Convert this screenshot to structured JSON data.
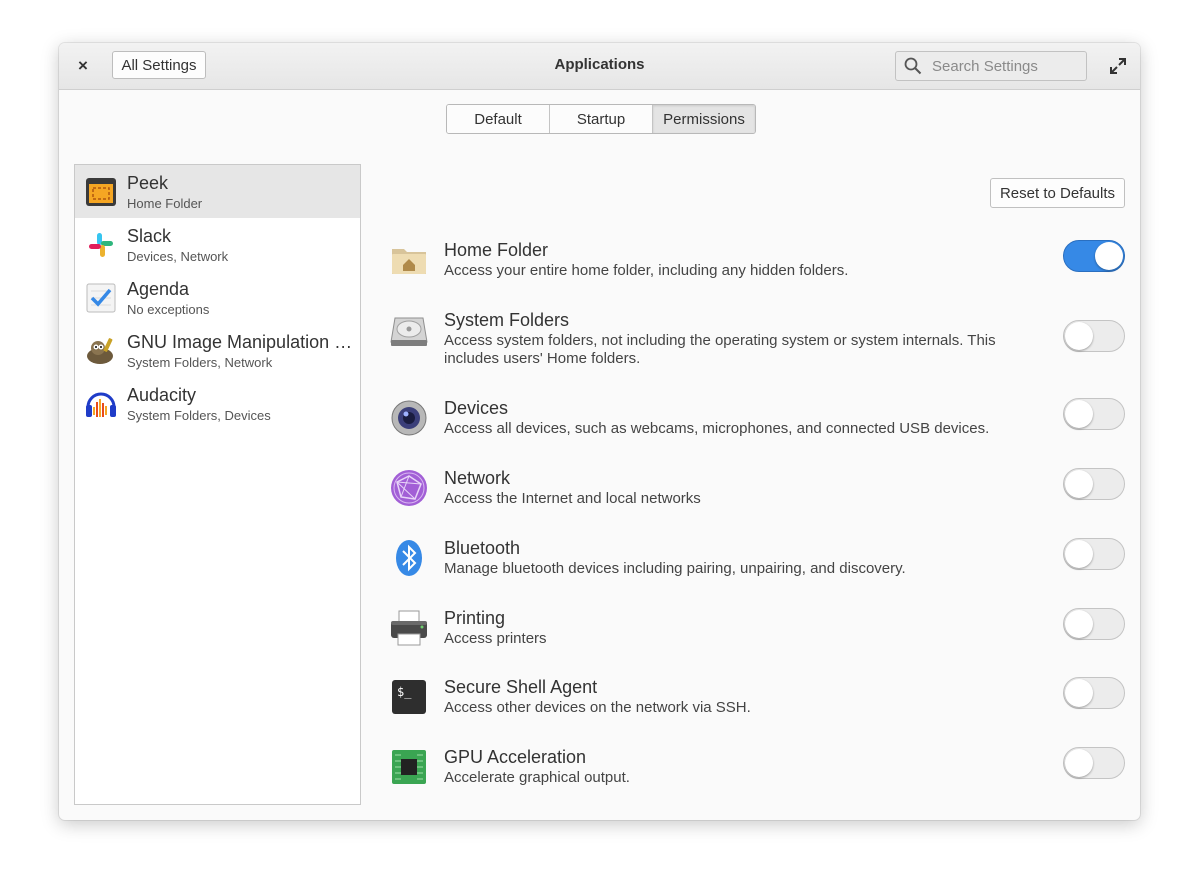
{
  "header": {
    "close_label": "×",
    "all_settings_label": "All Settings",
    "title": "Applications",
    "search_placeholder": "Search Settings"
  },
  "tabs": [
    {
      "label": "Default",
      "active": false
    },
    {
      "label": "Startup",
      "active": false
    },
    {
      "label": "Permissions",
      "active": true
    }
  ],
  "apps": [
    {
      "name": "Peek",
      "sub": "Home Folder",
      "icon": "peek-icon",
      "selected": true
    },
    {
      "name": "Slack",
      "sub": "Devices, Network",
      "icon": "slack-icon",
      "selected": false
    },
    {
      "name": "Agenda",
      "sub": "No exceptions",
      "icon": "agenda-icon",
      "selected": false
    },
    {
      "name": "GNU Image Manipulation Program",
      "sub": "System Folders, Network",
      "icon": "gimp-icon",
      "selected": false
    },
    {
      "name": "Audacity",
      "sub": "System Folders, Devices",
      "icon": "audacity-icon",
      "selected": false
    }
  ],
  "reset_label": "Reset to Defaults",
  "permissions": [
    {
      "title": "Home Folder",
      "desc": "Access your entire home folder, including any hidden folders.",
      "icon": "home-folder-icon",
      "enabled": true
    },
    {
      "title": "System Folders",
      "desc": "Access system folders, not including the operating system or system internals. This includes users' Home folders.",
      "icon": "drive-icon",
      "enabled": false
    },
    {
      "title": "Devices",
      "desc": "Access all devices, such as webcams, microphones, and connected USB devices.",
      "icon": "camera-icon",
      "enabled": false
    },
    {
      "title": "Network",
      "desc": "Access the Internet and local networks",
      "icon": "network-icon",
      "enabled": false
    },
    {
      "title": "Bluetooth",
      "desc": "Manage bluetooth devices including pairing, unpairing, and discovery.",
      "icon": "bluetooth-icon",
      "enabled": false
    },
    {
      "title": "Printing",
      "desc": "Access printers",
      "icon": "printer-icon",
      "enabled": false
    },
    {
      "title": "Secure Shell Agent",
      "desc": "Access other devices on the network via SSH.",
      "icon": "terminal-icon",
      "enabled": false
    },
    {
      "title": "GPU Acceleration",
      "desc": "Accelerate graphical output.",
      "icon": "gpu-icon",
      "enabled": false
    }
  ],
  "colors": {
    "accent": "#3689e6"
  }
}
